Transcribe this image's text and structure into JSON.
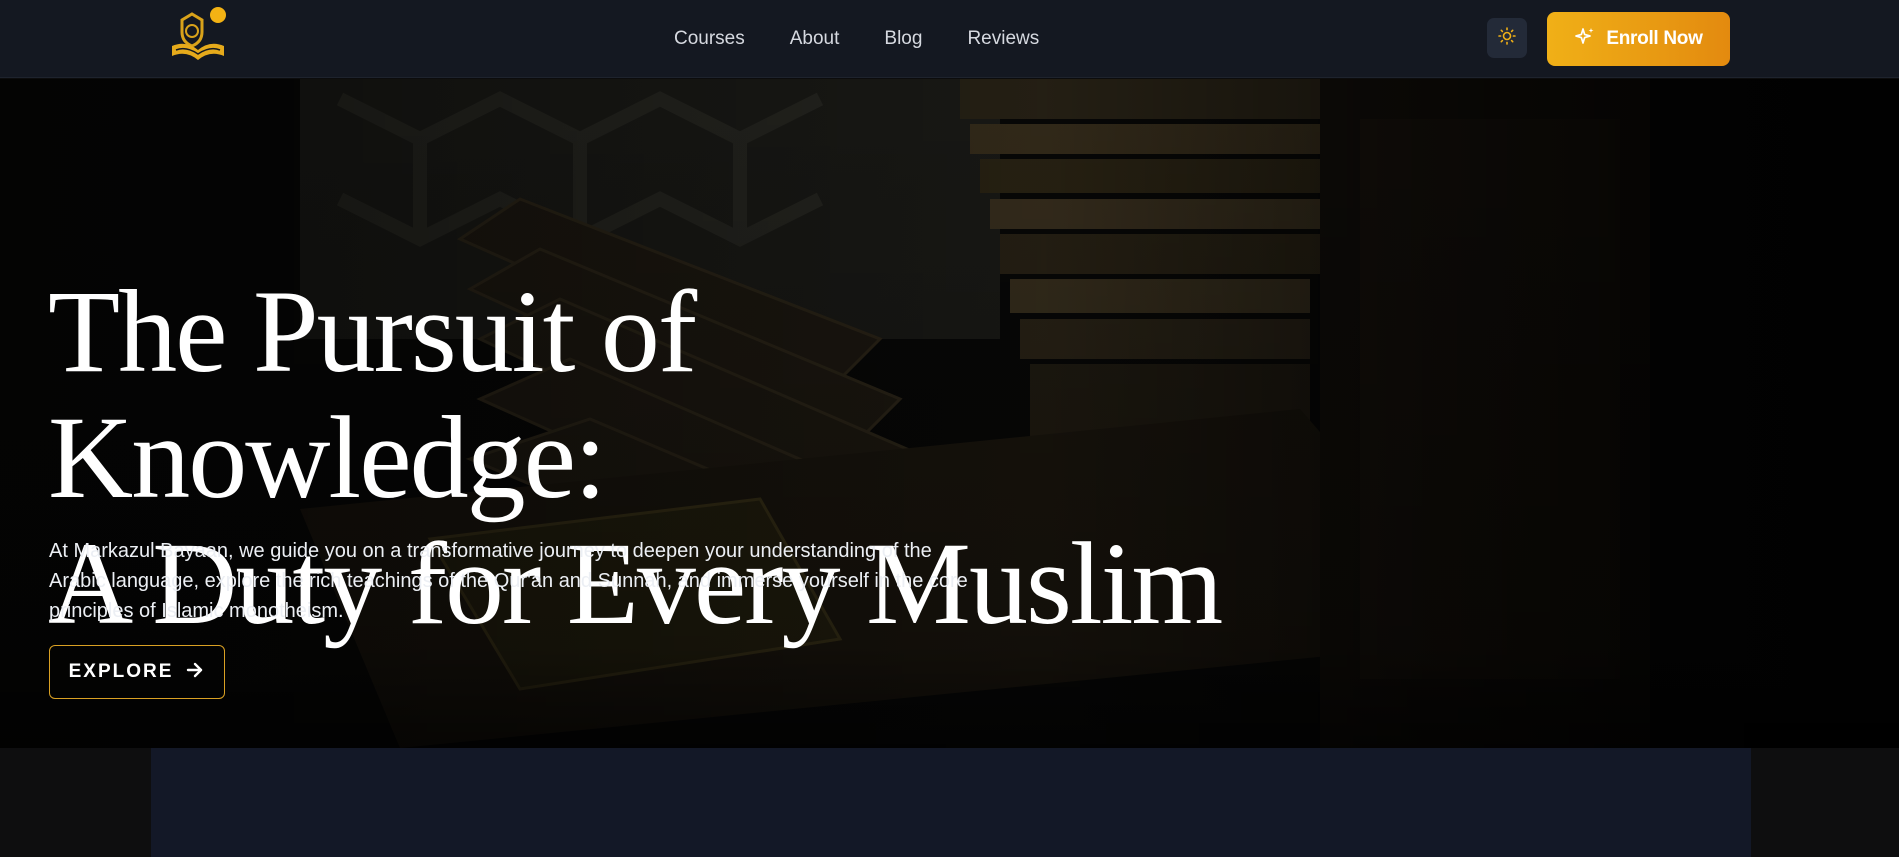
{
  "header": {
    "nav": [
      "Courses",
      "About",
      "Blog",
      "Reviews"
    ],
    "theme_icon": "sun-icon",
    "enroll_label": "Enroll Now",
    "enroll_icon": "sparkles-icon",
    "logo_icon": "book-crest-logo"
  },
  "hero": {
    "title_line1": "The Pursuit of Knowledge:",
    "title_line2": "A Duty for Every Muslim",
    "description": "At Markazul Bayaan, we guide you on a transformative journey to deepen your understanding of the Arabic language, explore the rich teachings of the Qur'an and Sunnah, and immerse yourself in the core principles of Islamic monotheism.",
    "explore_label": "EXPLORE",
    "explore_icon": "arrow-right-icon"
  },
  "colors": {
    "accent": "#f0b017",
    "accent_dark": "#e38a0f",
    "header_bg": "#141821",
    "panel_bg": "#131827"
  }
}
